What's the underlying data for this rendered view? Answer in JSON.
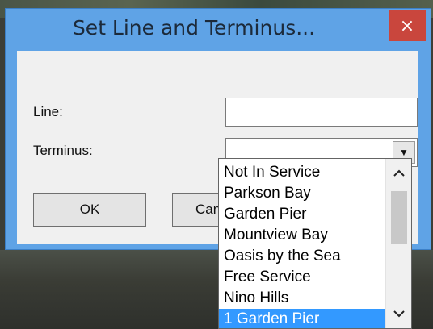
{
  "dialog": {
    "title": "Set Line and Terminus...",
    "close_icon": "×"
  },
  "form": {
    "line_label": "Line:",
    "line_value": "",
    "terminus_label": "Terminus:",
    "terminus_value": "",
    "ok_label": "OK",
    "cancel_label": "Cancel"
  },
  "dropdown": {
    "options": [
      "Not In Service",
      "Parkson Bay",
      "Garden Pier",
      "Mountview Bay",
      "Oasis by the Sea",
      "Free Service",
      "Nino Hills",
      "1 Garden Pier"
    ],
    "selected_index": 7,
    "scroll_up_icon": "chevron-up-icon",
    "scroll_down_icon": "chevron-down-icon"
  },
  "colors": {
    "title_bar": "#5fa3e6",
    "close_button": "#c9463d",
    "selection": "#3399ff"
  }
}
